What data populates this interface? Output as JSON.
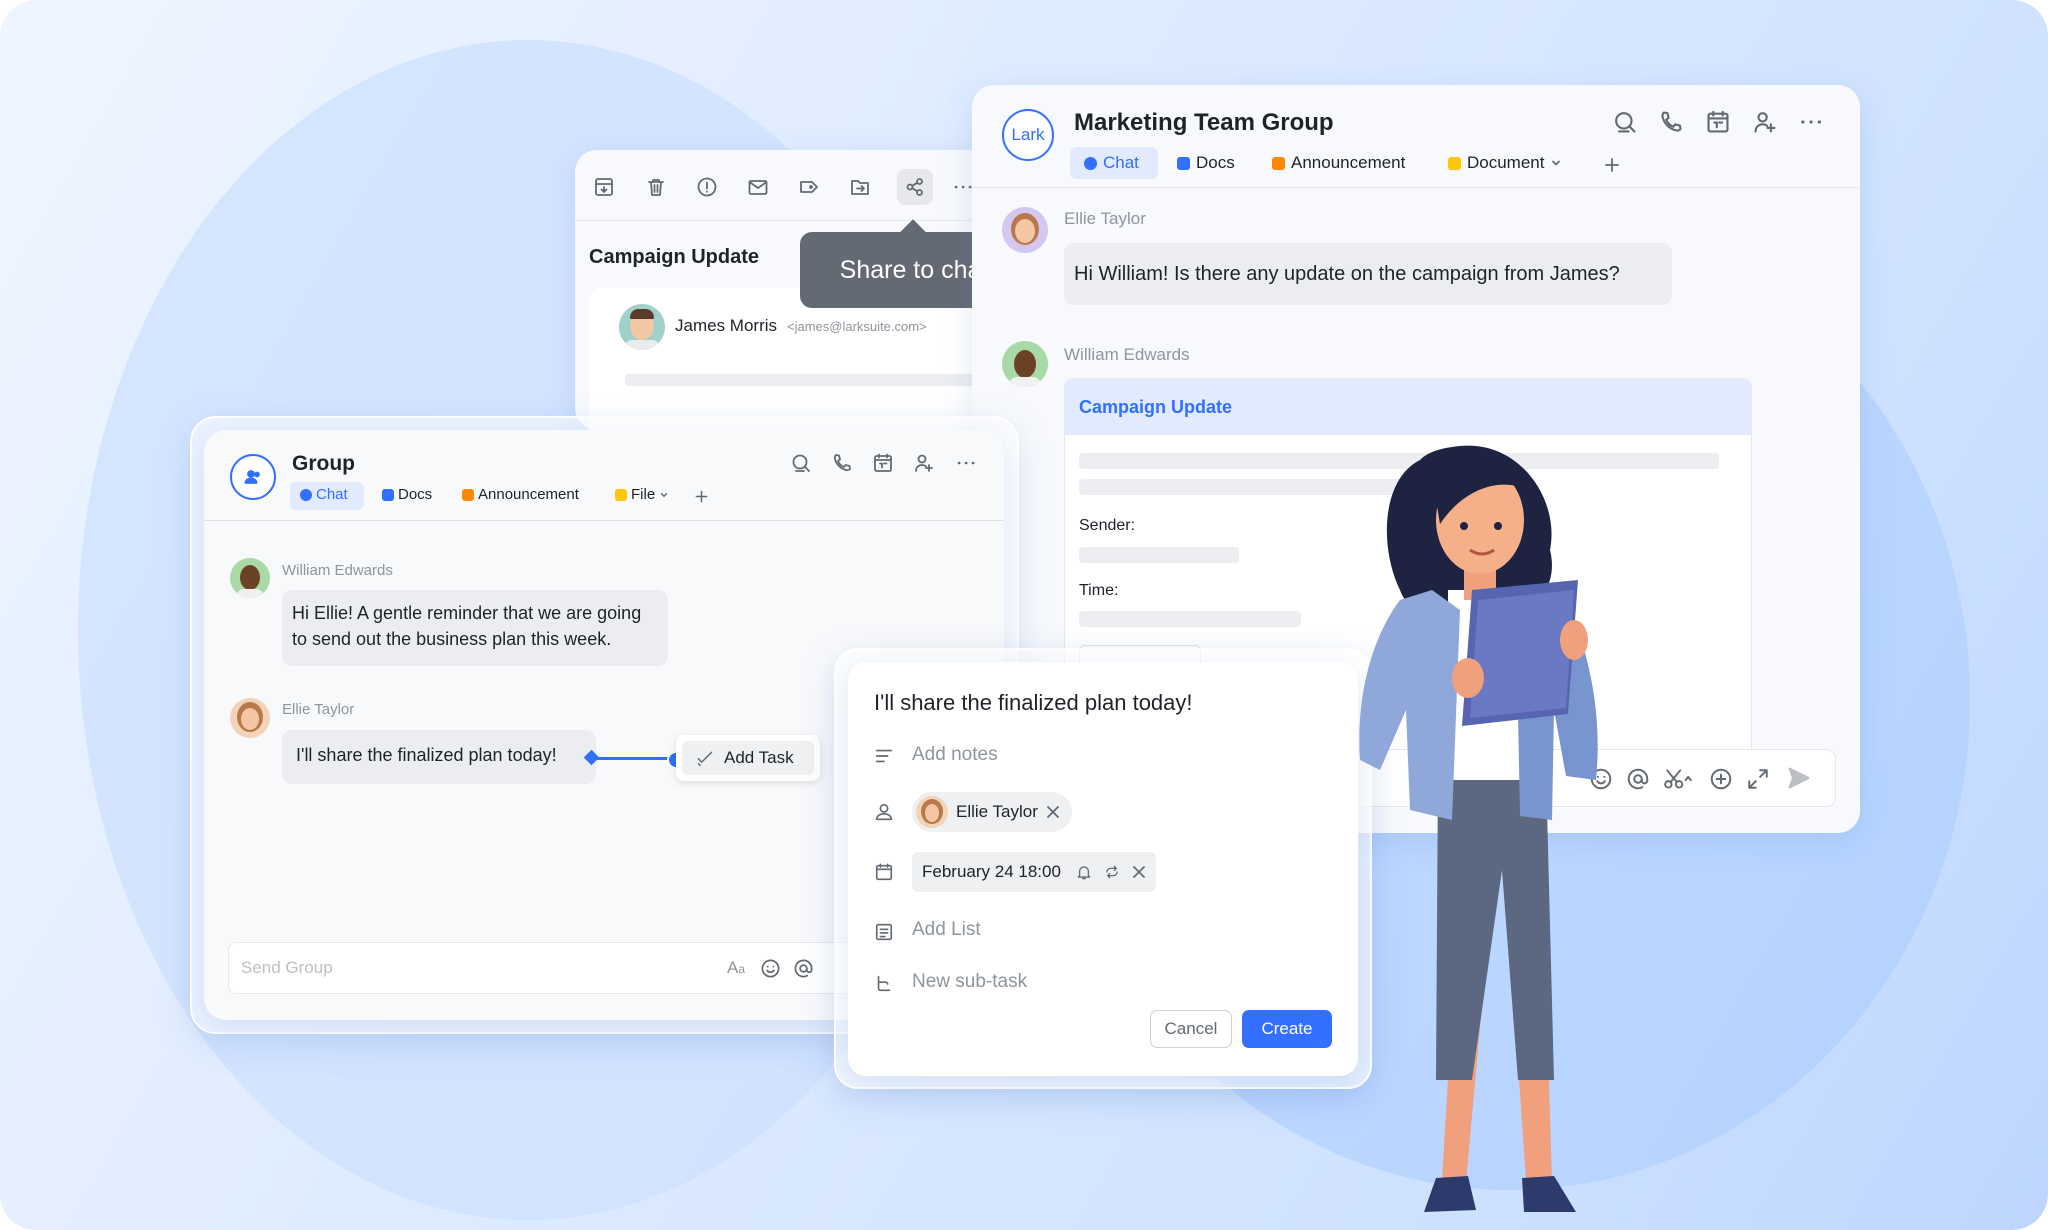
{
  "colors": {
    "accent": "#3370ff",
    "bubble": "#ebedf0",
    "muted": "#8f959e"
  },
  "mail_window": {
    "toolbar_icons": [
      "archive-icon",
      "trash-icon",
      "alert-icon",
      "mark-mail-icon",
      "label-icon",
      "move-folder-icon",
      "share-icon",
      "more-icon"
    ],
    "tooltip": "Share to chat",
    "subject": "Campaign Update",
    "sender_name": "James Morris",
    "sender_email": "<james@larksuite.com>"
  },
  "team_window": {
    "logo": "Lark",
    "title": "Marketing Team Group",
    "tabs": [
      {
        "label": "Chat"
      },
      {
        "label": "Docs"
      },
      {
        "label": "Announcement"
      },
      {
        "label": "Document"
      }
    ],
    "messages": [
      {
        "sender": "Ellie Taylor",
        "text": "Hi William! Is there any update on the campaign from James?"
      },
      {
        "sender": "William Edwards"
      }
    ],
    "card": {
      "title": "Campaign Update",
      "sender_label": "Sender:",
      "time_label": "Time:"
    }
  },
  "group_window": {
    "title": "Group",
    "tabs": [
      {
        "label": "Chat"
      },
      {
        "label": "Docs"
      },
      {
        "label": "Announcement"
      },
      {
        "label": "File"
      }
    ],
    "messages": [
      {
        "sender": "William Edwards",
        "text_line1": "Hi Ellie! A gentle reminder that we are going",
        "text_line2": "to send out the business plan this week."
      },
      {
        "sender": "Ellie Taylor",
        "text": "I'll share the finalized plan today!"
      }
    ],
    "add_task_label": "Add Task",
    "input_placeholder": "Send Group"
  },
  "task_panel": {
    "title": "I'll share the finalized plan today!",
    "notes_placeholder": "Add notes",
    "assignee": "Ellie Taylor",
    "due": "February 24 18:00",
    "list_placeholder": "Add List",
    "subtask_placeholder": "New sub-task",
    "cancel_label": "Cancel",
    "create_label": "Create"
  }
}
